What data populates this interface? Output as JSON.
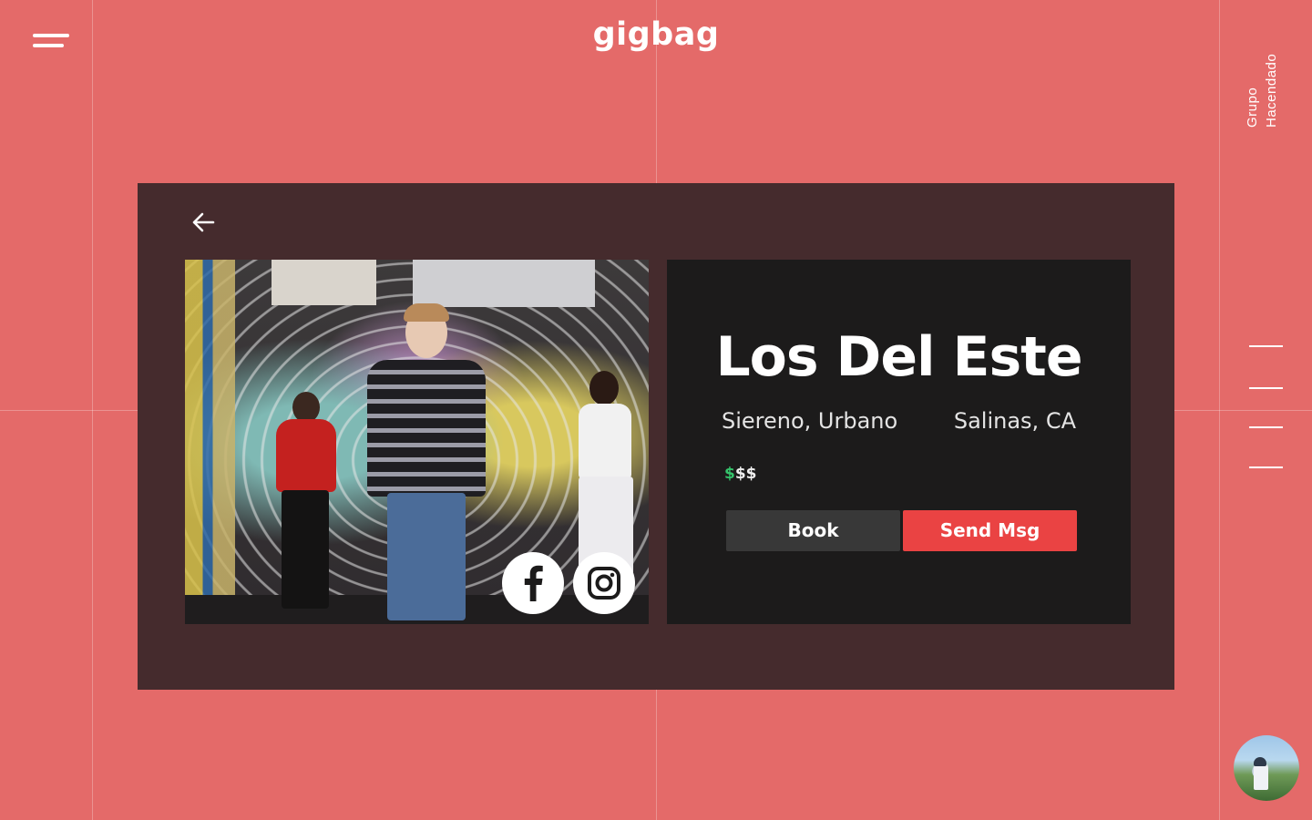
{
  "app": {
    "logo": "gigbag"
  },
  "sidebar": {
    "label": "Grupo Hacendado",
    "nav_dashes": 4
  },
  "colors": {
    "background": "#e46a69",
    "card": "#452b2d",
    "info_panel": "#1c1b1b",
    "book_button": "#383838",
    "send_button": "#ea4343",
    "price_active": "#35c46b"
  },
  "profile": {
    "name": "Los Del Este",
    "genre": "Siereno, Urbano",
    "location": "Salinas, CA",
    "price": {
      "active": "$",
      "inactive": "$$",
      "level": 1,
      "max": 3
    },
    "actions": {
      "book_label": "Book",
      "message_label": "Send Msg"
    },
    "social": [
      "facebook-icon",
      "instagram-icon"
    ]
  },
  "icons": [
    "menu-icon",
    "back-arrow-icon",
    "facebook-icon",
    "instagram-icon"
  ]
}
